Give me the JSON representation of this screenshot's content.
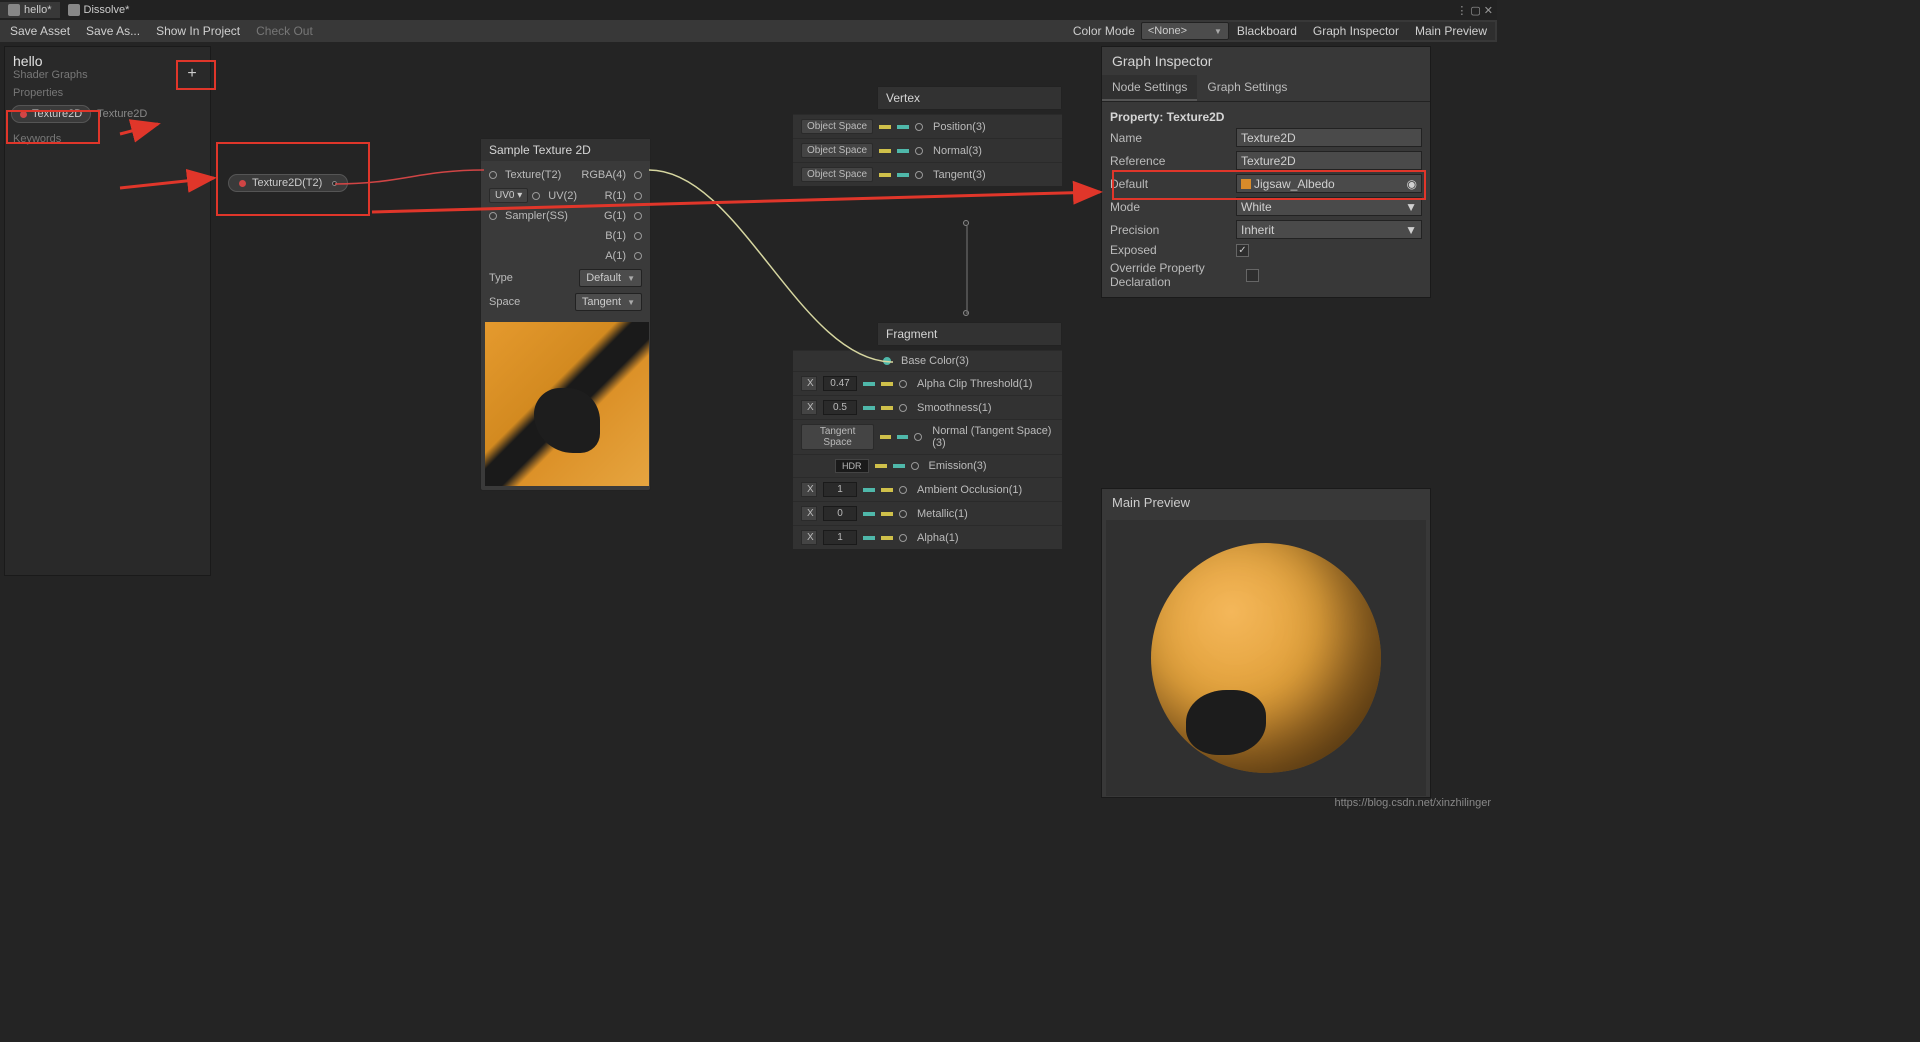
{
  "tabs": {
    "active": "hello*",
    "inactive": "Dissolve*"
  },
  "toolbar": {
    "save_asset": "Save Asset",
    "save_as": "Save As...",
    "show_in_project": "Show In Project",
    "check_out": "Check Out",
    "color_mode": "Color Mode",
    "color_mode_value": "<None>",
    "blackboard": "Blackboard",
    "graph_inspector": "Graph Inspector",
    "main_preview": "Main Preview"
  },
  "blackboard": {
    "title": "hello",
    "subtitle": "Shader Graphs",
    "plus": "+",
    "section_props": "Properties",
    "prop0": "Texture2D",
    "prop0_type": "Texture2D",
    "section_keywords": "Keywords"
  },
  "prop_node": {
    "label": "Texture2D(T2)"
  },
  "sample_node": {
    "title": "Sample Texture 2D",
    "in_tex": "Texture(T2)",
    "in_uv": "UV(2)",
    "in_uv_tag": "UV0",
    "in_sampler": "Sampler(SS)",
    "out_rgba": "RGBA(4)",
    "out_r": "R(1)",
    "out_g": "G(1)",
    "out_b": "B(1)",
    "out_a": "A(1)",
    "type_lbl": "Type",
    "type_val": "Default",
    "space_lbl": "Space",
    "space_val": "Tangent"
  },
  "vertex": {
    "title": "Vertex",
    "rows": [
      {
        "tag": "Object Space",
        "label": "Position(3)"
      },
      {
        "tag": "Object Space",
        "label": "Normal(3)"
      },
      {
        "tag": "Object Space",
        "label": "Tangent(3)"
      }
    ]
  },
  "fragment": {
    "title": "Fragment",
    "rows": [
      {
        "tag": "",
        "field": "",
        "label": "Base Color(3)"
      },
      {
        "tag": "X",
        "field": "0.47",
        "label": "Alpha Clip Threshold(1)"
      },
      {
        "tag": "X",
        "field": "0.5",
        "label": "Smoothness(1)"
      },
      {
        "tag": "Tangent Space",
        "field": "",
        "label": "Normal (Tangent Space)(3)"
      },
      {
        "tag": "HDR",
        "field": "",
        "label": "Emission(3)"
      },
      {
        "tag": "X",
        "field": "1",
        "label": "Ambient Occlusion(1)"
      },
      {
        "tag": "X",
        "field": "0",
        "label": "Metallic(1)"
      },
      {
        "tag": "X",
        "field": "1",
        "label": "Alpha(1)"
      }
    ]
  },
  "inspector": {
    "title": "Graph Inspector",
    "tab_node": "Node Settings",
    "tab_graph": "Graph Settings",
    "header": "Property: Texture2D",
    "name_lbl": "Name",
    "name_val": "Texture2D",
    "ref_lbl": "Reference",
    "ref_val": "Texture2D",
    "default_lbl": "Default",
    "default_val": "Jigsaw_Albedo",
    "mode_lbl": "Mode",
    "mode_val": "White",
    "precision_lbl": "Precision",
    "precision_val": "Inherit",
    "exposed_lbl": "Exposed",
    "override_lbl": "Override Property Declaration"
  },
  "preview": {
    "title": "Main Preview"
  },
  "watermark": "https://blog.csdn.net/xinzhilinger"
}
